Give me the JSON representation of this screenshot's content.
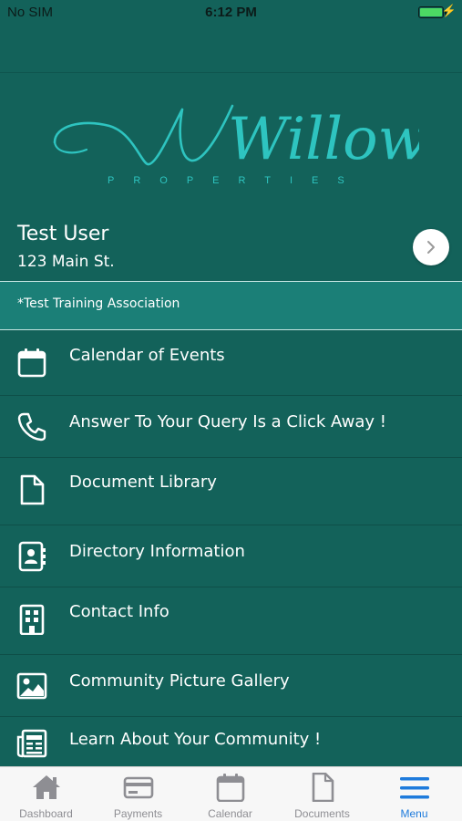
{
  "status_bar": {
    "carrier": "No SIM",
    "time": "6:12 PM"
  },
  "logo": {
    "script_text": "Willow",
    "subtitle": "PROPERTIES"
  },
  "profile": {
    "name": "Test User",
    "address": "123 Main St."
  },
  "association": {
    "label": "*Test Training Association"
  },
  "menu": {
    "items": [
      {
        "label": "Calendar of Events",
        "icon": "calendar-icon"
      },
      {
        "label": "Answer To Your Query Is a Click Away !",
        "icon": "phone-icon"
      },
      {
        "label": "Document Library",
        "icon": "document-icon"
      },
      {
        "label": "Directory Information",
        "icon": "contact-book-icon"
      },
      {
        "label": "Contact Info",
        "icon": "building-icon"
      },
      {
        "label": "Community Picture Gallery",
        "icon": "image-icon"
      },
      {
        "label": "Learn About Your Community !",
        "icon": "newspaper-icon"
      }
    ]
  },
  "tabs": [
    {
      "label": "Dashboard",
      "icon": "home-icon"
    },
    {
      "label": "Payments",
      "icon": "credit-card-icon"
    },
    {
      "label": "Calendar",
      "icon": "calendar-icon"
    },
    {
      "label": "Documents",
      "icon": "document-icon"
    },
    {
      "label": "Menu",
      "icon": "menu-icon",
      "active": true
    }
  ],
  "colors": {
    "background": "#13625a",
    "association_band": "#1b7f77",
    "logo_accent": "#2ec4c0",
    "tab_active": "#1e7bdc",
    "tab_inactive": "#8e8e93"
  }
}
